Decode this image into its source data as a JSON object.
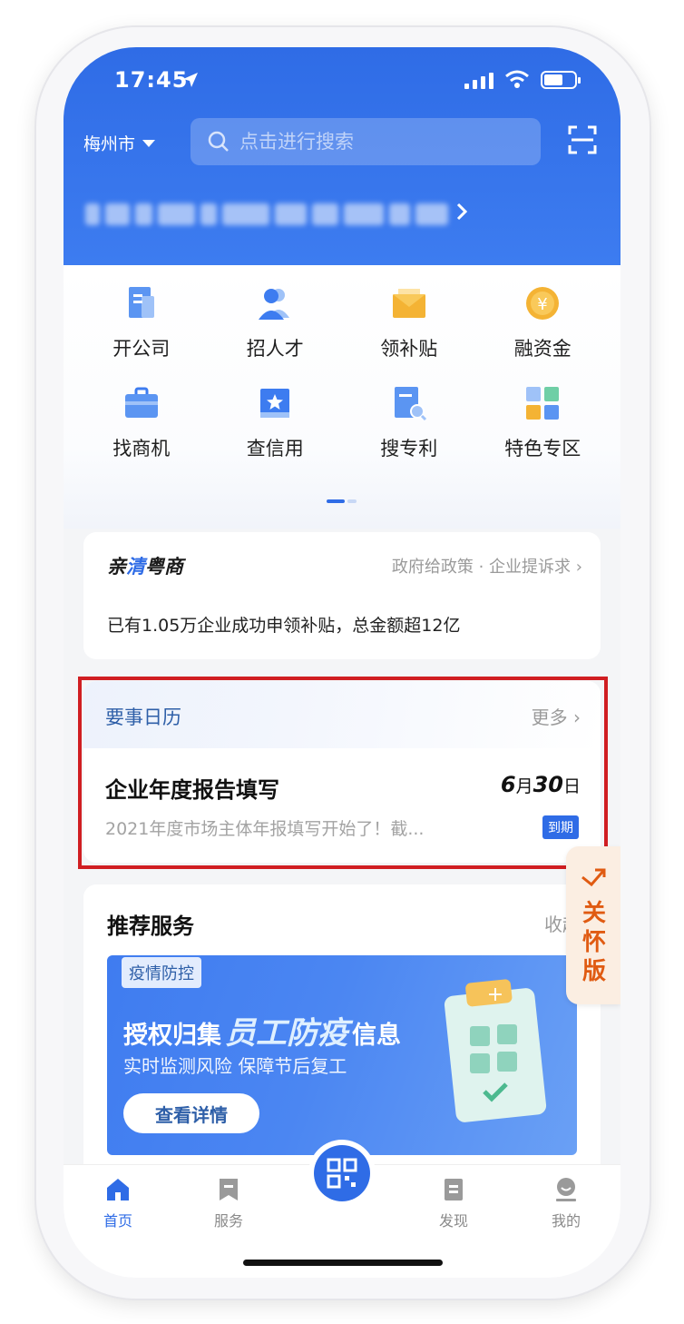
{
  "status_bar": {
    "time": "17:45"
  },
  "header": {
    "city": "梅州市",
    "search_placeholder": "点击进行搜索"
  },
  "quick_grid": [
    {
      "label": "开公司",
      "icon": "building-doc-icon"
    },
    {
      "label": "招人才",
      "icon": "people-icon"
    },
    {
      "label": "领补贴",
      "icon": "envelope-icon"
    },
    {
      "label": "融资金",
      "icon": "yen-coin-icon"
    },
    {
      "label": "找商机",
      "icon": "briefcase-icon"
    },
    {
      "label": "查信用",
      "icon": "star-book-icon"
    },
    {
      "label": "搜专利",
      "icon": "doc-search-icon"
    },
    {
      "label": "特色专区",
      "icon": "tiles-icon"
    }
  ],
  "qinqing": {
    "brand_prefix": "亲",
    "brand_mid": "清",
    "brand_suffix": "粤商",
    "links": "政府给政策 · 企业提诉求",
    "note": "已有1.05万企业成功申领补贴，总金额超12亿"
  },
  "calendar": {
    "title": "要事日历",
    "more": "更多",
    "event_title": "企业年度报告填写",
    "date_num_month": "6",
    "date_month_unit": "月",
    "date_num_day": "30",
    "date_day_unit": "日",
    "description": "2021年度市场主体年报填写开始了！截...",
    "badge": "到期"
  },
  "recommend": {
    "title": "推荐服务",
    "collapse": "收起",
    "banner": {
      "tag": "疫情防控",
      "headline_a": "授权归集",
      "headline_em": "员工防疫",
      "headline_b": "信息",
      "subline": "实时监测风险 保障节后复工",
      "button": "查看详情"
    }
  },
  "care_mode": {
    "label": "关怀版"
  },
  "tabbar": [
    {
      "label": "首页",
      "icon": "home-icon",
      "active": true
    },
    {
      "label": "服务",
      "icon": "bookmark-icon",
      "active": false
    },
    {
      "label": "发现",
      "icon": "document-icon",
      "active": false
    },
    {
      "label": "我的",
      "icon": "user-icon",
      "active": false
    }
  ],
  "colors": {
    "brand_blue": "#2f6ce6",
    "highlight_red": "#d01e22",
    "care_orange": "#e05b12"
  }
}
